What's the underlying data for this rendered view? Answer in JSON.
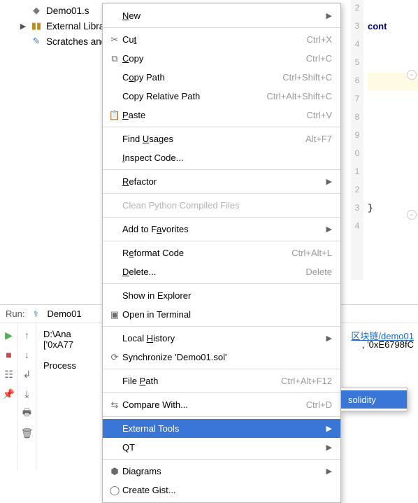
{
  "tree": {
    "file": "Demo01.s",
    "ext_libs": "External Libra",
    "scratches": "Scratches and"
  },
  "editor": {
    "lines": [
      "2",
      "3",
      "4",
      "5",
      "6",
      "7",
      "8",
      "9",
      "0",
      "1",
      "2",
      "3",
      "4"
    ],
    "code": {
      "l3": "cont",
      "l14": "}"
    }
  },
  "run": {
    "label": "Run:",
    "config": "Demo01",
    "console_path": "D:\\Ana",
    "console_list_prefix": "['0xA77",
    "process": "Process",
    "link_tail": "区块链/demo01",
    "list_tail": ", '0xE6798fC"
  },
  "menu": {
    "new": "New",
    "cut": "Cut",
    "copy": "Copy",
    "copy_path": "Copy Path",
    "copy_rel": "Copy Relative Path",
    "paste": "Paste",
    "find_usages": "Find Usages",
    "inspect": "Inspect Code...",
    "refactor": "Refactor",
    "clean_py": "Clean Python Compiled Files",
    "add_fav": "Add to Favorites",
    "reformat": "Reformat Code",
    "delete": "Delete...",
    "show_explorer": "Show in Explorer",
    "open_terminal": "Open in Terminal",
    "local_history": "Local History",
    "sync": "Synchronize 'Demo01.sol'",
    "file_path": "File Path",
    "compare": "Compare With...",
    "external_tools": "External Tools",
    "qt": "QT",
    "diagrams": "Diagrams",
    "create_gist": "Create Gist...",
    "sc_cut": "Ctrl+X",
    "sc_copy": "Ctrl+C",
    "sc_copy_path": "Ctrl+Shift+C",
    "sc_copy_rel": "Ctrl+Alt+Shift+C",
    "sc_paste": "Ctrl+V",
    "sc_find": "Alt+F7",
    "sc_reformat": "Ctrl+Alt+L",
    "sc_delete": "Delete",
    "sc_file_path": "Ctrl+Alt+F12",
    "sc_compare": "Ctrl+D"
  },
  "submenu": {
    "solidity": "solidity"
  }
}
